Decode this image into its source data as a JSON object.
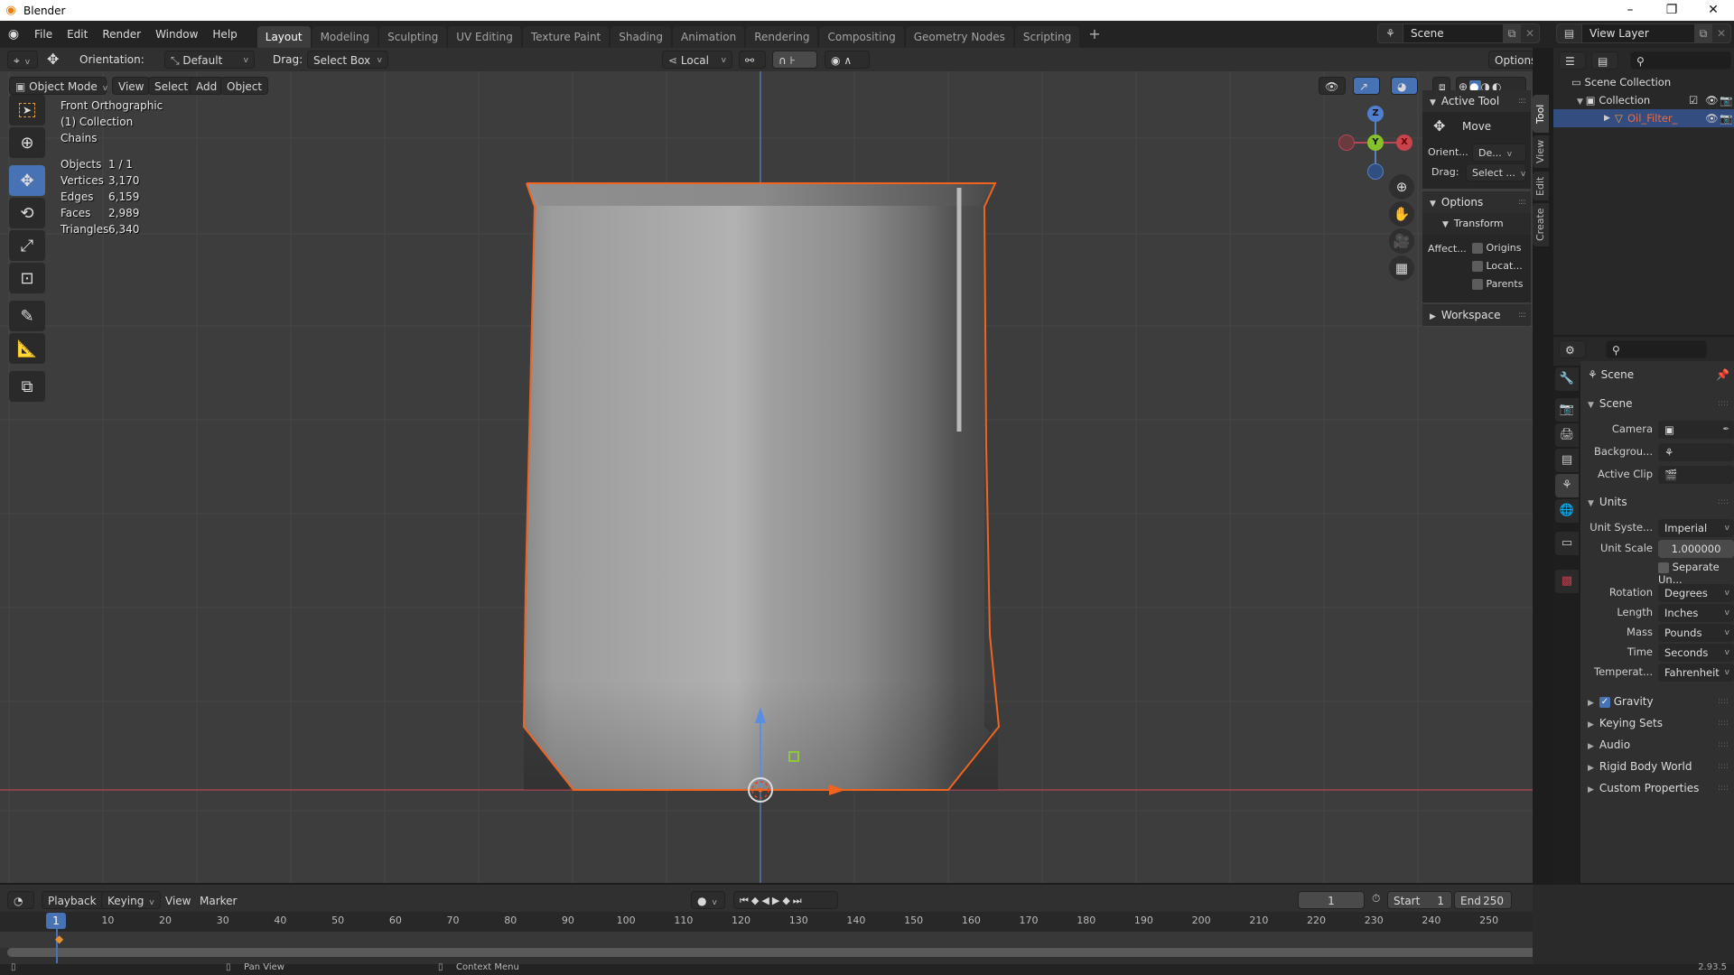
{
  "window": {
    "title": "Blender",
    "controls": [
      "minimize",
      "restore",
      "close"
    ]
  },
  "menu": [
    "File",
    "Edit",
    "Render",
    "Window",
    "Help"
  ],
  "workspace_tabs": [
    {
      "label": "Layout",
      "active": true
    },
    {
      "label": "Modeling"
    },
    {
      "label": "Sculpting"
    },
    {
      "label": "UV Editing"
    },
    {
      "label": "Texture Paint"
    },
    {
      "label": "Shading"
    },
    {
      "label": "Animation"
    },
    {
      "label": "Rendering"
    },
    {
      "label": "Compositing"
    },
    {
      "label": "Geometry Nodes"
    },
    {
      "label": "Scripting"
    }
  ],
  "scene_selector": {
    "value": "Scene"
  },
  "view_layer_selector": {
    "value": "View Layer"
  },
  "tool_header": {
    "orientation_label": "Orientation:",
    "orientation_value": "Default",
    "drag_label": "Drag:",
    "drag_value": "Select Box",
    "pivot_value": "Local",
    "options_label": "Options"
  },
  "viewport_header": {
    "mode": "Object Mode",
    "menus": [
      "View",
      "Select",
      "Add",
      "Object"
    ]
  },
  "viewport_overlay": {
    "view_name": "Front Orthographic",
    "collection": "(1) Collection",
    "object_name": "Chains",
    "stats": [
      {
        "label": "Objects",
        "value": "1 / 1"
      },
      {
        "label": "Vertices",
        "value": "3,170"
      },
      {
        "label": "Edges",
        "value": "6,159"
      },
      {
        "label": "Faces",
        "value": "2,989"
      },
      {
        "label": "Triangles",
        "value": "6,340"
      }
    ]
  },
  "toolbar": [
    {
      "name": "select-box",
      "active": false
    },
    {
      "name": "cursor",
      "active": false
    },
    {
      "name": "move",
      "active": true
    },
    {
      "name": "rotate",
      "active": false
    },
    {
      "name": "scale",
      "active": false
    },
    {
      "name": "transform",
      "active": false
    },
    {
      "name": "annotate",
      "active": false
    },
    {
      "name": "measure",
      "active": false
    },
    {
      "name": "add-cube",
      "active": false
    }
  ],
  "gizmo": {
    "axes": [
      "Z",
      "Y",
      "X"
    ]
  },
  "npanel": {
    "tabs": [
      "Tool",
      "View",
      "Edit",
      "Create"
    ],
    "active_tab": "Tool",
    "active_tool_header": "Active Tool",
    "active_tool_name": "Move",
    "orient_label": "Orient...",
    "orient_value": "De...",
    "drag_label": "Drag:",
    "drag_value": "Select ...",
    "options_header": "Options",
    "transform_header": "Transform",
    "affect_label": "Affect...",
    "affect_options": [
      {
        "label": "Origins",
        "checked": false
      },
      {
        "label": "Locat...",
        "checked": false
      },
      {
        "label": "Parents",
        "checked": false
      }
    ],
    "workspace_header": "Workspace"
  },
  "outliner": {
    "root": "Scene Collection",
    "collection": "Collection",
    "object": "Oil_Filter_"
  },
  "properties": {
    "context": "Scene",
    "scene_panel": "Scene",
    "camera_label": "Camera",
    "background_label": "Backgrou...",
    "active_clip_label": "Active Clip",
    "units_panel": "Units",
    "unit_system_label": "Unit Syste...",
    "unit_system": "Imperial",
    "unit_scale_label": "Unit Scale",
    "unit_scale": "1.000000",
    "separate_units_label": "Separate Un...",
    "separate_units": false,
    "rotation_label": "Rotation",
    "rotation": "Degrees",
    "length_label": "Length",
    "length": "Inches",
    "mass_label": "Mass",
    "mass": "Pounds",
    "time_label": "Time",
    "time": "Seconds",
    "temperature_label": "Temperat...",
    "temperature": "Fahrenheit",
    "collapsed_panels": [
      {
        "label": "Gravity",
        "checkbox": true
      },
      {
        "label": "Keying Sets"
      },
      {
        "label": "Audio"
      },
      {
        "label": "Rigid Body World"
      },
      {
        "label": "Custom Properties"
      }
    ]
  },
  "timeline": {
    "menus": [
      "Playback",
      "Keying",
      "View",
      "Marker"
    ],
    "current_frame": "1",
    "start_label": "Start",
    "start": "1",
    "end_label": "End",
    "end": "250",
    "ruler": [
      "10",
      "20",
      "30",
      "40",
      "50",
      "60",
      "70",
      "80",
      "90",
      "100",
      "110",
      "120",
      "130",
      "140",
      "150",
      "160",
      "170",
      "180",
      "190",
      "200",
      "210",
      "220",
      "230",
      "240",
      "250"
    ],
    "playhead": "1"
  },
  "statusbar": {
    "pan_view": "Pan View",
    "context_menu": "Context Menu",
    "version": "2.93.5"
  },
  "colors": {
    "accent": "#4772b3",
    "selection_outline": "#f06420",
    "object_active": "#e8602c"
  }
}
